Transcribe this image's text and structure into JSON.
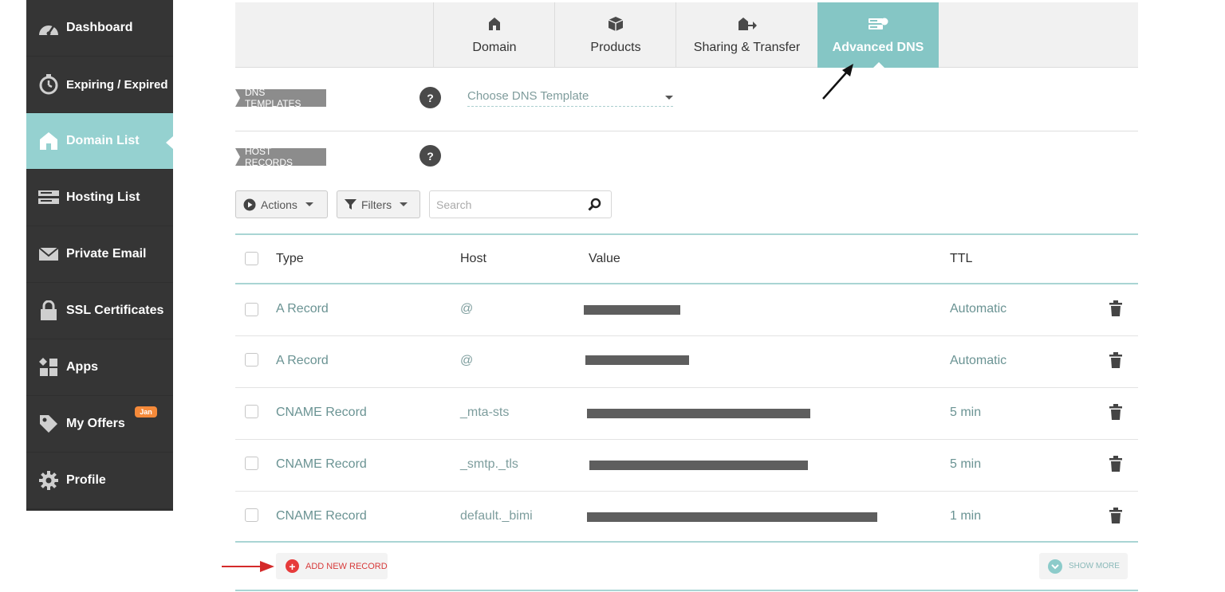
{
  "sidebar": {
    "items": [
      {
        "label": "Dashboard",
        "icon": "gauge-icon"
      },
      {
        "label": "Expiring / Expired",
        "icon": "stopwatch-icon"
      },
      {
        "label": "Domain List",
        "icon": "home-icon",
        "active": true
      },
      {
        "label": "Hosting List",
        "icon": "server-icon"
      },
      {
        "label": "Private Email",
        "icon": "envelope-icon"
      },
      {
        "label": "SSL Certificates",
        "icon": "lock-icon"
      },
      {
        "label": "Apps",
        "icon": "apps-icon"
      },
      {
        "label": "My Offers",
        "icon": "tag-icon",
        "badge": "Jan"
      },
      {
        "label": "Profile",
        "icon": "gear-icon"
      }
    ]
  },
  "tabs": [
    {
      "label": "Domain",
      "icon": "home-icon"
    },
    {
      "label": "Products",
      "icon": "box-icon"
    },
    {
      "label": "Sharing & Transfer",
      "icon": "share-transfer-icon"
    },
    {
      "label": "Advanced DNS",
      "icon": "dns-server-icon",
      "active": true
    }
  ],
  "dns_templates": {
    "label": "DNS TEMPLATES",
    "help": "?",
    "select_value": "Choose DNS Template"
  },
  "host_records": {
    "label": "HOST RECORDS",
    "help": "?"
  },
  "toolbar": {
    "actions_label": "Actions",
    "filters_label": "Filters",
    "search_placeholder": "Search"
  },
  "table": {
    "headers": {
      "type": "Type",
      "host": "Host",
      "value": "Value",
      "ttl": "TTL"
    },
    "rows": [
      {
        "type": "A Record",
        "host": "@",
        "value": "[redacted]",
        "ttl": "Automatic"
      },
      {
        "type": "A Record",
        "host": "@",
        "value": "[redacted]",
        "ttl": "Automatic"
      },
      {
        "type": "CNAME Record",
        "host": "_mta-sts",
        "value": "[redacted]",
        "ttl": "5 min"
      },
      {
        "type": "CNAME Record",
        "host": "_smtp._tls",
        "value": "[redacted]",
        "ttl": "5 min"
      },
      {
        "type": "CNAME Record",
        "host": "default._bimi",
        "value": "[redacted]",
        "ttl": "1 min"
      }
    ]
  },
  "footer": {
    "add_label": "ADD NEW RECORD",
    "show_more_label": "SHOW MORE"
  },
  "colors": {
    "sidebar_bg": "#353535",
    "accent_teal": "#85c6c5",
    "add_red": "#e63b3b"
  }
}
